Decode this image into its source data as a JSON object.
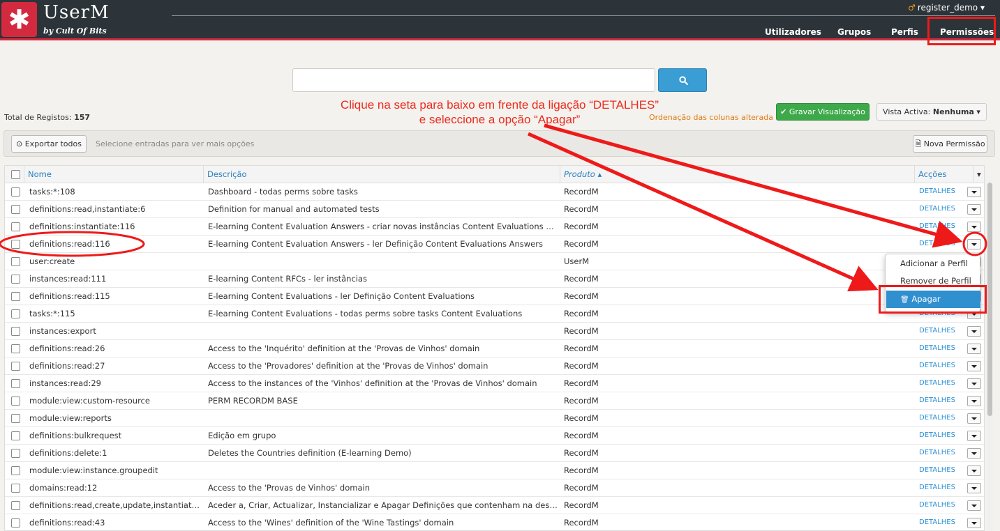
{
  "app": {
    "logo_glyph": "✱",
    "name": "UserM",
    "tagline": "by Cult Of Bits",
    "accent": "#d42a3f"
  },
  "user": {
    "name": "register_demo",
    "caret": "▾"
  },
  "nav": {
    "items": [
      "Utilizadores",
      "Grupos",
      "Perfis",
      "Permissões"
    ],
    "active": "Permissões"
  },
  "search": {
    "placeholder": "",
    "button_icon": "search-icon"
  },
  "summary": {
    "label": "Total de Registos:",
    "count": "157"
  },
  "annotation": {
    "line1": "Clique na seta para baixo em frente da ligação “DETALHES”",
    "line2": "e seleccione a opção “Apagar”",
    "color": "#ee2b1d"
  },
  "view": {
    "columns_changed": "Ordenação das colunas alterada",
    "save_label": "✔ Gravar Visualização",
    "active_view_label": "Vista Activa:",
    "active_view_value": "Nenhuma",
    "active_view_caret": "▾"
  },
  "toolbar": {
    "export_label": "⊙ Exportar todos",
    "hint": "Selecione entradas para ver mais opções",
    "new_label": "Nova Permissão",
    "new_icon": "document-icon"
  },
  "table": {
    "headers": {
      "name": "Nome",
      "description": "Descrição",
      "product": "Produto ▴",
      "actions": "Acções"
    },
    "details_label": "DETALHES",
    "rows": [
      {
        "name": "tasks:*:108",
        "description": "Dashboard - todas perms sobre tasks",
        "product": "RecordM"
      },
      {
        "name": "definitions:read,instantiate:6",
        "description": "Definition for manual and automated tests",
        "product": "RecordM"
      },
      {
        "name": "definitions:instantiate:116",
        "description": "E-learning Content Evaluation Answers - criar novas instâncias Content Evaluations Answers",
        "product": "RecordM"
      },
      {
        "name": "definitions:read:116",
        "description": "E-learning Content Evaluation Answers - ler Definição Content Evaluations Answers",
        "product": "RecordM"
      },
      {
        "name": "user:create",
        "description": "",
        "product": "UserM"
      },
      {
        "name": "instances:read:111",
        "description": "E-learning Content RFCs - ler instâncias",
        "product": "RecordM"
      },
      {
        "name": "definitions:read:115",
        "description": "E-learning Content Evaluations - ler Definição Content Evaluations",
        "product": "RecordM"
      },
      {
        "name": "tasks:*:115",
        "description": "E-learning Content Evaluations - todas perms sobre tasks Content Evaluations",
        "product": "RecordM"
      },
      {
        "name": "instances:export",
        "description": "",
        "product": "RecordM"
      },
      {
        "name": "definitions:read:26",
        "description": "Access to the 'Inquérito' definition at the 'Provas de Vinhos' domain",
        "product": "RecordM"
      },
      {
        "name": "definitions:read:27",
        "description": "Access to the 'Provadores' definition at the 'Provas de Vinhos' domain",
        "product": "RecordM"
      },
      {
        "name": "instances:read:29",
        "description": "Access to the instances of the 'Vinhos' definition at the 'Provas de Vinhos' domain",
        "product": "RecordM"
      },
      {
        "name": "module:view:custom-resource",
        "description": "PERM RECORDM BASE",
        "product": "RecordM"
      },
      {
        "name": "module:view:reports",
        "description": "",
        "product": "RecordM"
      },
      {
        "name": "definitions:bulkrequest",
        "description": "Edição em grupo",
        "product": "RecordM"
      },
      {
        "name": "definitions:delete:1",
        "description": "Deletes the Countries definition (E-learning Demo)",
        "product": "RecordM"
      },
      {
        "name": "module:view:instance.groupedit",
        "description": "",
        "product": "RecordM"
      },
      {
        "name": "domains:read:12",
        "description": "Access to the 'Provas de Vinhos' domain",
        "product": "RecordM"
      },
      {
        "name": "definitions:read,create,update,instantiate,...",
        "description": "Aceder a, Criar, Actualizar, Instancializar e Apagar Definições que contenham na descrição...",
        "product": "RecordM"
      },
      {
        "name": "definitions:read:43",
        "description": "Access to the 'Wines' definition of the 'Wine Tastings' domain",
        "product": "RecordM"
      }
    ]
  },
  "dropdown": {
    "items": [
      "Adicionar a Perfil",
      "Remover de Perfil",
      "Apagar"
    ],
    "delete_icon": "trash-icon",
    "delete_glyph": "🗑"
  }
}
